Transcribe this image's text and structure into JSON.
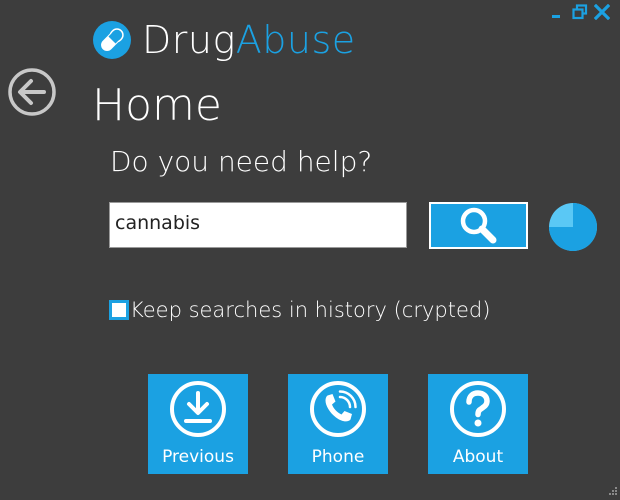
{
  "app": {
    "title_part1": "Drug",
    "title_part2": "Abuse"
  },
  "page": {
    "title": "Home",
    "question": "Do you need help?"
  },
  "search": {
    "value": "cannabis",
    "placeholder": ""
  },
  "history": {
    "checked": false,
    "label": "Keep searches in history (crypted)"
  },
  "tiles": [
    {
      "label": "Previous",
      "icon": "download-icon"
    },
    {
      "label": "Phone",
      "icon": "phone-icon"
    },
    {
      "label": "About",
      "icon": "question-icon"
    }
  ],
  "progress": {
    "fraction": 0.75
  },
  "colors": {
    "accent": "#1ba1e2",
    "background": "#3d3d3d",
    "pie_light": "#5ac8f5",
    "pie_dark": "#1ba1e2"
  },
  "icons": {
    "logo": "pill-icon",
    "back": "back-arrow-icon",
    "search": "magnifier-icon",
    "progress": "pie-chart-icon",
    "window_controls": [
      "minimize-icon",
      "restore-icon",
      "close-icon"
    ],
    "resize": "resize-grip-icon"
  }
}
